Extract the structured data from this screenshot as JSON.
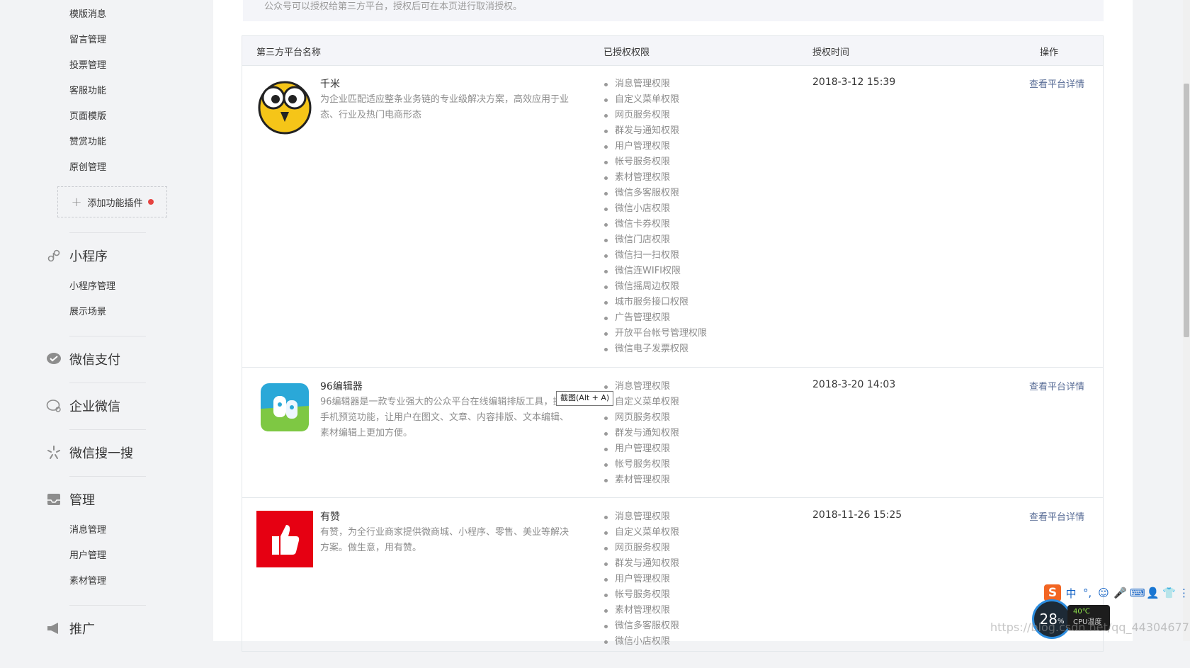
{
  "sidebar": {
    "feature_items": [
      "模版消息",
      "留言管理",
      "投票管理",
      "客服功能",
      "页面模版",
      "赞赏功能",
      "原创管理"
    ],
    "add_plugin_label": "添加功能插件",
    "miniprogram": {
      "title": "小程序",
      "items": [
        "小程序管理",
        "展示场景"
      ]
    },
    "wechat_pay": {
      "title": "微信支付"
    },
    "work_wechat": {
      "title": "企业微信"
    },
    "wechat_search": {
      "title": "微信搜一搜"
    },
    "manage": {
      "title": "管理",
      "items": [
        "消息管理",
        "用户管理",
        "素材管理"
      ]
    },
    "promote": {
      "title": "推广"
    }
  },
  "notice": "公众号可以授权给第三方平台，授权后可在本页进行取消授权。",
  "table": {
    "headers": [
      "第三方平台名称",
      "已授权权限",
      "授权时间",
      "操作"
    ],
    "rows": [
      {
        "name": "千米",
        "desc": "为企业匹配适应整条业务链的专业级解决方案，高效应用于业态、行业及热门电商形态",
        "perms": [
          "消息管理权限",
          "自定义菜单权限",
          "网页服务权限",
          "群发与通知权限",
          "用户管理权限",
          "帐号服务权限",
          "素材管理权限",
          "微信多客服权限",
          "微信小店权限",
          "微信卡券权限",
          "微信门店权限",
          "微信扫一扫权限",
          "微信连WIFI权限",
          "微信摇周边权限",
          "城市服务接口权限",
          "广告管理权限",
          "开放平台帐号管理权限",
          "微信电子发票权限"
        ],
        "time": "2018-3-12 15:39",
        "action": "查看平台详情"
      },
      {
        "name": "96编辑器",
        "desc": "96编辑器是一款专业强大的公众平台在线编辑排版工具，提供手机预览功能，让用户在图文、文章、内容排版、文本编辑、素材编辑上更加方便。",
        "perms": [
          "消息管理权限",
          "自定义菜单权限",
          "网页服务权限",
          "群发与通知权限",
          "用户管理权限",
          "帐号服务权限",
          "素材管理权限"
        ],
        "time": "2018-3-20 14:03",
        "action": "查看平台详情"
      },
      {
        "name": "有赞",
        "desc": "有赞，为全行业商家提供微商城、小程序、零售、美业等解决方案。做生意，用有赞。",
        "perms": [
          "消息管理权限",
          "自定义菜单权限",
          "网页服务权限",
          "群发与通知权限",
          "用户管理权限",
          "帐号服务权限",
          "素材管理权限",
          "微信多客服权限",
          "微信小店权限"
        ],
        "time": "2018-11-26 15:25",
        "action": "查看平台详情"
      }
    ]
  },
  "tooltip": "截图(Alt + A)",
  "ime": {
    "logo": "S",
    "buttons": [
      "中",
      "°,",
      "☺",
      "🎤",
      "⌨",
      "👤",
      "👕",
      "⋮⋮"
    ]
  },
  "monitor": {
    "cpu": "28",
    "cpu_unit": "%",
    "temp": "40℃",
    "temp_label": "CPU温度"
  },
  "watermark": "https://blog.csdn.net/qq_44304677"
}
